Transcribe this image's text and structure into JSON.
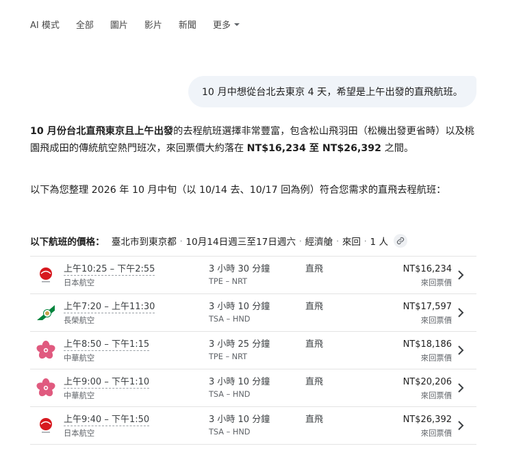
{
  "tabs": [
    {
      "label": "AI 模式"
    },
    {
      "label": "全部"
    },
    {
      "label": "圖片"
    },
    {
      "label": "影片"
    },
    {
      "label": "新聞"
    },
    {
      "label": "更多"
    }
  ],
  "query": "10 月中想從台北去東京 4 天，希望是上午出發的直飛航班。",
  "answer": {
    "p1_bold": "10 月份台北直飛東京且上午出發",
    "p1_text1": "的去程航班選擇非常豐富，包含松山飛羽田（松機出發更省時）以及桃園飛成田的傳統航空熱門班次，來回票價大約落在 ",
    "p1_price_range": "NT$16,234 至 NT$26,392",
    "p1_text2": " 之間。",
    "p2": "以下為您整理 2026 年 10 月中旬（以 10/14 去、10/17 回為例）符合您需求的直飛去程航班："
  },
  "flight_header": {
    "title": "以下航班的價格：",
    "route": "臺北市到東京都",
    "dates": "10月14日週三至17日週六",
    "cabin": "經濟艙",
    "trip": "來回",
    "passengers": "1 人",
    "separator": "·"
  },
  "flights": [
    {
      "time": "上午10:25 – 下午2:55",
      "airline": "日本航空",
      "logo": "jal",
      "duration": "3 小時 30 分鐘",
      "route": "TPE – NRT",
      "stops": "直飛",
      "price": "NT$16,234",
      "price_type": "來回票價"
    },
    {
      "time": "上午7:20 – 上午11:30",
      "airline": "長榮航空",
      "logo": "eva",
      "duration": "3 小時 10 分鐘",
      "route": "TSA – HND",
      "stops": "直飛",
      "price": "NT$17,597",
      "price_type": "來回票價"
    },
    {
      "time": "上午8:50 – 下午1:15",
      "airline": "中華航空",
      "logo": "ci",
      "duration": "3 小時 25 分鐘",
      "route": "TPE – NRT",
      "stops": "直飛",
      "price": "NT$18,186",
      "price_type": "來回票價"
    },
    {
      "time": "上午9:00 – 下午1:10",
      "airline": "中華航空",
      "logo": "ci",
      "duration": "3 小時 10 分鐘",
      "route": "TSA – HND",
      "stops": "直飛",
      "price": "NT$20,206",
      "price_type": "來回票價"
    },
    {
      "time": "上午9:40 – 下午1:50",
      "airline": "日本航空",
      "logo": "jal",
      "duration": "3 小時 10 分鐘",
      "route": "TSA – HND",
      "stops": "直飛",
      "price": "NT$26,392",
      "price_type": "來回票價"
    }
  ],
  "colors": {
    "jal_red": "#d7191f",
    "eva_green": "#00843d",
    "ci_pink": "#e05a7f",
    "bubble_bg": "#f0f4f9"
  }
}
